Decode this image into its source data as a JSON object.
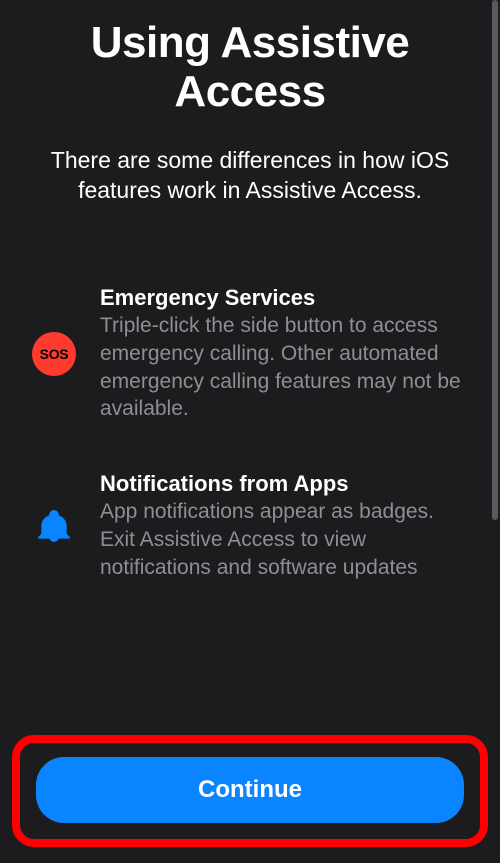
{
  "title": "Using Assistive Access",
  "subtitle": "There are some differences in how iOS features work in Assistive Access.",
  "items": [
    {
      "icon": "sos",
      "icon_label": "SOS",
      "title": "Emergency Services",
      "description": "Triple-click the side button to access emergency calling. Other automated emergency calling features may not be available."
    },
    {
      "icon": "bell",
      "title": "Notifications from Apps",
      "description": "App notifications appear as badges. Exit Assistive Access to view notifications and software updates"
    }
  ],
  "continue_button": "Continue"
}
